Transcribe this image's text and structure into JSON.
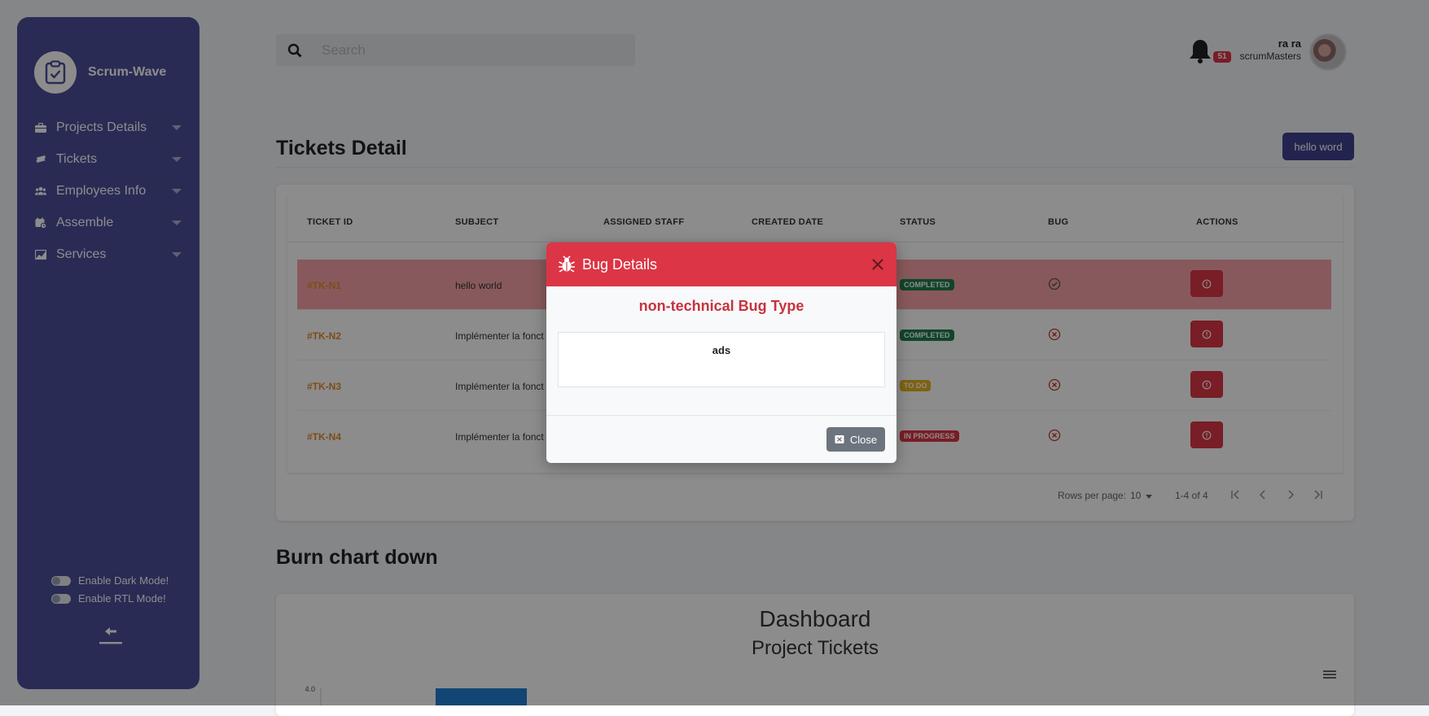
{
  "app": {
    "name": "Scrum-Wave"
  },
  "sidebar": {
    "items": [
      {
        "label": "Projects Details",
        "icon": "briefcase-icon"
      },
      {
        "label": "Tickets",
        "icon": "ticket-icon"
      },
      {
        "label": "Employees Info",
        "icon": "users-icon"
      },
      {
        "label": "Assemble",
        "icon": "calendar-icon"
      },
      {
        "label": "Services",
        "icon": "chart-icon"
      }
    ],
    "dark_mode_label": "Enable Dark Mode!",
    "rtl_mode_label": "Enable RTL Mode!"
  },
  "header": {
    "search_placeholder": "Search",
    "notification_count": "51",
    "user_name": "ra ra",
    "user_role": "scrumMasters"
  },
  "tickets": {
    "title": "Tickets Detail",
    "action_button": "hello word",
    "columns": [
      "TICKET ID",
      "SUBJECT",
      "ASSIGNED STAFF",
      "CREATED DATE",
      "STATUS",
      "BUG",
      "ACTIONS"
    ],
    "rows": [
      {
        "id": "#TK-N1",
        "subject": "hello world",
        "status": "COMPLETED",
        "status_color": "#1e7e4e",
        "bug": "check",
        "highlight": true
      },
      {
        "id": "#TK-N2",
        "subject": "Implémenter la fonct",
        "status": "COMPLETED",
        "status_color": "#1e7e4e",
        "bug": "cross",
        "highlight": false
      },
      {
        "id": "#TK-N3",
        "subject": "Implémenter la fonct",
        "status": "TO DO",
        "status_color": "#e6b31e",
        "bug": "cross",
        "highlight": false
      },
      {
        "id": "#TK-N4",
        "subject": "Implémenter la fonct",
        "status": "IN PROGRESS",
        "status_color": "#dc3545",
        "bug": "cross",
        "highlight": false
      }
    ],
    "pagination": {
      "rows_per_page_label": "Rows per page:",
      "rows_per_page": "10",
      "range": "1-4 of 4"
    }
  },
  "burn_chart": {
    "section_title": "Burn chart down",
    "title": "Dashboard",
    "subtitle": "Project Tickets"
  },
  "chart_data": {
    "type": "bar",
    "title": "Dashboard",
    "subtitle": "Project Tickets",
    "y_tick_labels": [
      "4.0"
    ],
    "ylim": [
      0,
      4
    ],
    "series": [
      {
        "values": [
          4
        ]
      }
    ],
    "bar_color": "#1f7fd1"
  },
  "modal": {
    "title": "Bug Details",
    "bug_type": "non-technical Bug Type",
    "description": "ads",
    "close_label": "Close"
  },
  "colors": {
    "sidebar_bg": "#4b4f9b",
    "danger": "#dc3545",
    "primary_button": "#3f4391",
    "ticket_id": "#e48a2a"
  }
}
